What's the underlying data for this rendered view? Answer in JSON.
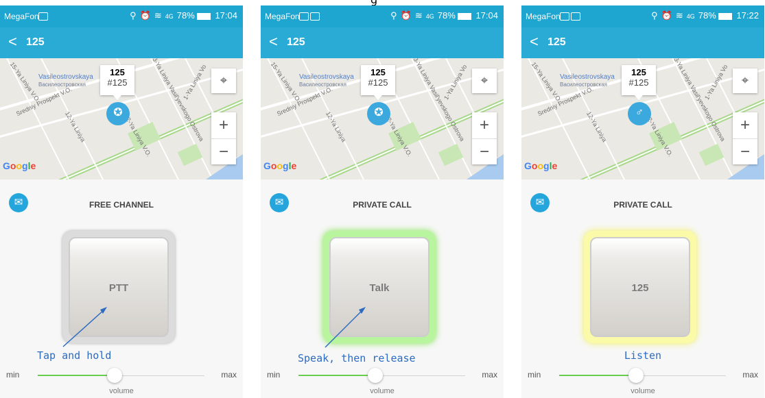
{
  "figure": {
    "title_fragment": "g"
  },
  "screens": [
    {
      "status": {
        "carrier": "MegaFon",
        "net": "4G",
        "battery": "78%",
        "time": "17:04"
      },
      "appbar": {
        "back": "<",
        "title": "125"
      },
      "map": {
        "popup_title": "125",
        "popup_sub": "#125",
        "marker_icon": "ribbon-icon",
        "metro_en": "Vasileostrovskaya",
        "metro_ru": "Василеостровская",
        "streets": [
          "15-Ya Liniya V.O.",
          "Sredniy Prospekt V.O.",
          "12-Ya Liniya",
          "2-Ya Liniya V.O.",
          "3-Ya Liniya Vasil'yevskogo Ostrova",
          "1-Ya Liniya Vo"
        ],
        "zoom_in": "+",
        "zoom_out": "−",
        "attribution": "Google"
      },
      "channel": "FREE CHANNEL",
      "button": {
        "label": "PTT",
        "glow": "grey"
      },
      "hint": "Tap and hold",
      "volume": {
        "min": "min",
        "max": "max",
        "label": "volume",
        "level": 0.46
      }
    },
    {
      "status": {
        "carrier": "MegaFon",
        "net": "4G",
        "battery": "78%",
        "time": "17:04"
      },
      "appbar": {
        "back": "<",
        "title": "125"
      },
      "map": {
        "popup_title": "125",
        "popup_sub": "#125",
        "marker_icon": "ribbon-icon",
        "metro_en": "Vasileostrovskaya",
        "metro_ru": "Василеостровская",
        "streets": [
          "15-Ya Liniya V.O.",
          "Sredniy Prospekt V.O.",
          "12-Ya Liniya",
          "2-Ya Liniya V.O.",
          "3-Ya Liniya Vasil'yevskogo Ostrova",
          "1-Ya Liniya Vo"
        ],
        "zoom_in": "+",
        "zoom_out": "−",
        "attribution": "Google"
      },
      "channel": "PRIVATE CALL",
      "button": {
        "label": "Talk",
        "glow": "green"
      },
      "hint": "Speak, then release",
      "volume": {
        "min": "min",
        "max": "max",
        "label": "volume",
        "level": 0.46
      }
    },
    {
      "status": {
        "carrier": "MegaFon",
        "net": "4G",
        "battery": "78%",
        "time": "17:22"
      },
      "appbar": {
        "back": "<",
        "title": "125"
      },
      "map": {
        "popup_title": "125",
        "popup_sub": "#125",
        "marker_icon": "male-icon",
        "metro_en": "Vasileostrovskaya",
        "metro_ru": "Василеостровская",
        "streets": [
          "15-Ya Liniya V.O.",
          "Sredniy Prospekt V.O.",
          "12-Ya Liniya",
          "2-Ya Liniya V.O.",
          "3-Ya Liniya Vasil'yevskogo Ostrova",
          "1-Ya Liniya Vo"
        ],
        "zoom_in": "+",
        "zoom_out": "−",
        "attribution": "Google"
      },
      "channel": "PRIVATE CALL",
      "button": {
        "label": "125",
        "glow": "yellow"
      },
      "hint": "Listen",
      "volume": {
        "min": "min",
        "max": "max",
        "label": "volume",
        "level": 0.46
      }
    }
  ],
  "colors": {
    "header": "#29abd5",
    "accent_green": "#67cf4b",
    "hint_blue": "#2c6bc0"
  }
}
